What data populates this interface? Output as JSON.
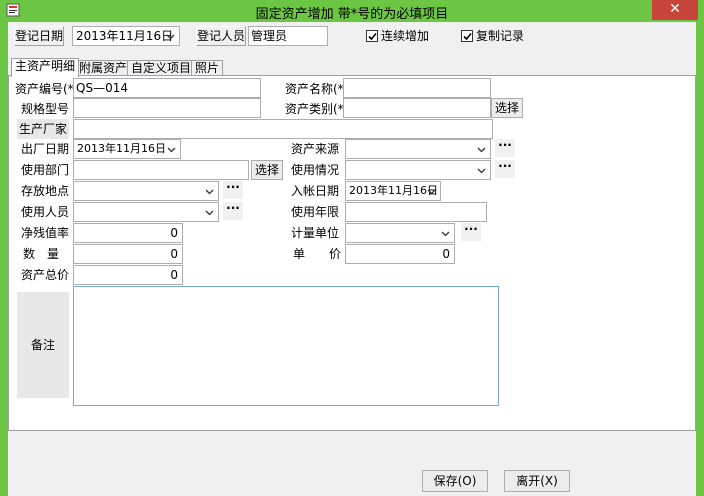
{
  "window": {
    "title": "固定资产增加 带*号的为必填项目",
    "close_glyph": "✕"
  },
  "header": {
    "reg_date_label": "登记日期",
    "reg_date_value": "2013年11月16日",
    "reg_person_label": "登记人员",
    "reg_person_value": "管理员",
    "continuous_add_label": "连续增加",
    "continuous_add_checked": true,
    "copy_record_label": "复制记录",
    "copy_record_checked": true
  },
  "tabs": [
    {
      "label": "主资产明细",
      "active": true
    },
    {
      "label": "附属资产",
      "active": false
    },
    {
      "label": "自定义项目",
      "active": false
    },
    {
      "label": "照片",
      "active": false
    }
  ],
  "form": {
    "asset_no_label": "资产编号(*)",
    "asset_no_value": "QS—014",
    "asset_name_label": "资产名称(*)",
    "asset_name_value": "",
    "spec_label": "规格型号",
    "spec_value": "",
    "category_label": "资产类别(*)",
    "category_value": "",
    "select_label": "选择",
    "manufacturer_label": "生产厂家",
    "manufacturer_value": "",
    "factory_date_label": "出厂日期",
    "factory_date_value": "2013年11月16日",
    "source_label": "资产来源",
    "source_value": "",
    "dept_label": "使用部门",
    "dept_value": "",
    "usage_label": "使用情况",
    "usage_value": "",
    "location_label": "存放地点",
    "location_value": "",
    "entry_date_label": "入帐日期",
    "entry_date_value": "2013年11月16日",
    "user_label": "使用人员",
    "user_value": "",
    "years_label": "使用年限",
    "years_value": "",
    "residual_label": "净残值率",
    "residual_value": "0",
    "unit_label": "计量单位",
    "unit_value": "",
    "qty_label": "数　量",
    "qty_value": "0",
    "price_label": "单　　价",
    "price_value": "0",
    "total_label": "资产总价",
    "total_value": "0",
    "memo_label": "备注",
    "memo_value": "",
    "ellipsis": "···"
  },
  "footer": {
    "save_label": "保存(O)",
    "leave_label": "离开(X)"
  },
  "colors": {
    "titlebar": "#6cc644",
    "close": "#c7443b",
    "memo_border": "#7ba7d8"
  }
}
